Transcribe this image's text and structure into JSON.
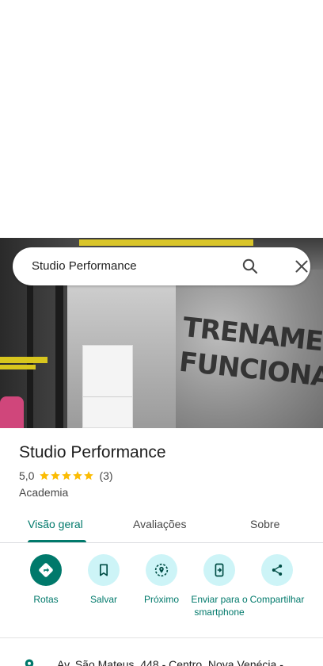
{
  "search": {
    "value": "Studio Performance"
  },
  "photo": {
    "wall_text": "TRENAMENTO FUNCIONAL"
  },
  "place": {
    "name": "Studio Performance",
    "rating": "5,0",
    "review_count": "(3)",
    "stars": 5,
    "category": "Academia"
  },
  "tabs": [
    {
      "label": "Visão geral",
      "active": true
    },
    {
      "label": "Avaliações",
      "active": false
    },
    {
      "label": "Sobre",
      "active": false
    }
  ],
  "actions": [
    {
      "label": "Rotas",
      "icon": "directions-icon"
    },
    {
      "label": "Salvar",
      "icon": "bookmark-icon"
    },
    {
      "label": "Próximo",
      "icon": "nearby-icon"
    },
    {
      "label": "Enviar para o smartphone",
      "icon": "send-to-phone-icon"
    },
    {
      "label": "Compartilhar",
      "icon": "share-icon"
    }
  ],
  "address": {
    "text": "Av. São Mateus, 448 - Centro, Nova Venécia -"
  },
  "colors": {
    "accent": "#00796b",
    "action_bg": "#cdf4f7",
    "star": "#fbbc04"
  }
}
